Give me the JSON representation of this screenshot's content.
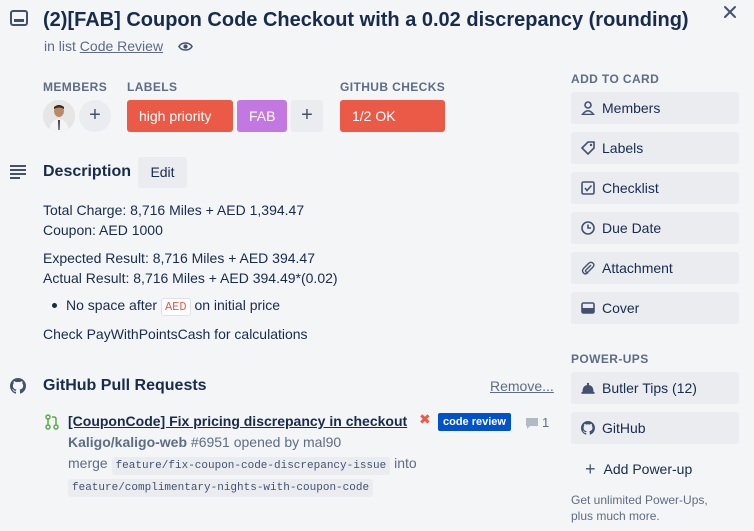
{
  "card": {
    "title": "(2)[FAB] Coupon Code Checkout with a 0.02 discrepancy (rounding)",
    "in_list_prefix": "in list",
    "list_name": "Code Review"
  },
  "members": {
    "label": "MEMBERS",
    "add": "+"
  },
  "labels": {
    "label": "LABELS",
    "items": [
      {
        "text": "high priority",
        "color": "#eb5a46"
      },
      {
        "text": "FAB",
        "color": "#c377e0"
      }
    ],
    "add": "+"
  },
  "github_checks": {
    "label": "GITHUB CHECKS",
    "status": "1/2 OK",
    "color": "#eb5a46"
  },
  "description": {
    "heading": "Description",
    "edit": "Edit",
    "lines": [
      "Total Charge: 8,716 Miles + AED 1,394.47",
      "Coupon: AED 1000",
      "Expected Result: 8,716 Miles + AED 394.47",
      "Actual Result: 8,716 Miles + AED 394.49*(0.02)"
    ],
    "bullet_before": "No space after",
    "bullet_code": "AED",
    "bullet_after": "on initial price",
    "footer": "Check PayWithPointsCash for calculations"
  },
  "github": {
    "heading": "GitHub Pull Requests",
    "remove": "Remove...",
    "pr": {
      "title": "[CouponCode] Fix pricing discrepancy in checkout",
      "status_mark": "✖",
      "badge": "code review",
      "comments": "1",
      "repo": "Kaligo/kaligo-web",
      "opened": "#6951 opened by mal90",
      "merge_word": "merge",
      "head_branch": "feature/fix-coupon-code-discrepancy-issue",
      "into_word": "into",
      "base_branch": "feature/complimentary-nights-with-coupon-code"
    }
  },
  "sidebar": {
    "add_to_card": "ADD TO CARD",
    "buttons": [
      {
        "label": "Members",
        "icon": "person-icon"
      },
      {
        "label": "Labels",
        "icon": "tag-icon"
      },
      {
        "label": "Checklist",
        "icon": "checkbox-icon"
      },
      {
        "label": "Due Date",
        "icon": "clock-icon"
      },
      {
        "label": "Attachment",
        "icon": "paperclip-icon"
      },
      {
        "label": "Cover",
        "icon": "card-cover-icon"
      }
    ],
    "power_ups": "POWER-UPS",
    "powerup_buttons": [
      {
        "label": "Butler Tips (12)",
        "icon": "butler-bell-icon"
      },
      {
        "label": "GitHub",
        "icon": "github-icon"
      }
    ],
    "add_powerup": "Add Power-up",
    "note_line1": "Get unlimited Power-Ups,",
    "note_line2": "plus much more."
  }
}
